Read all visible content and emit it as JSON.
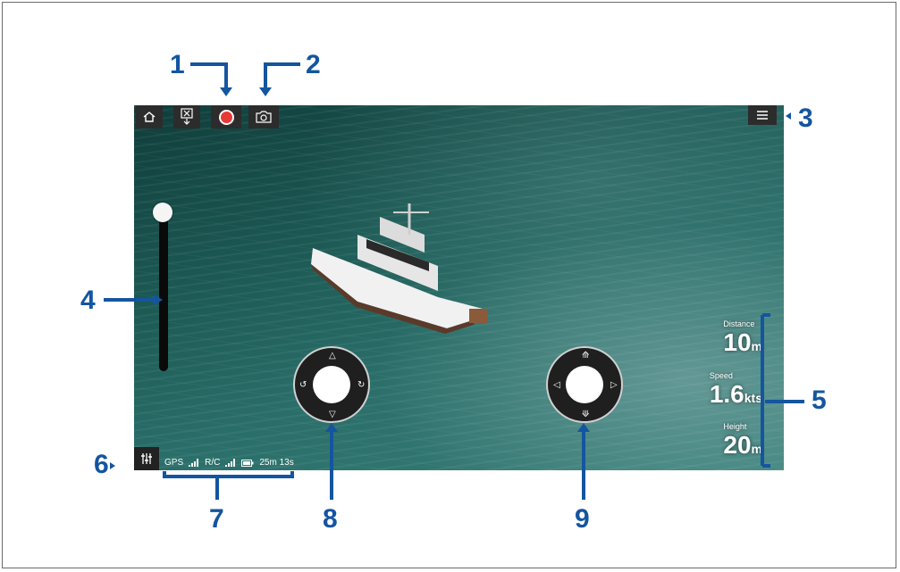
{
  "callouts": {
    "c1": "1",
    "c2": "2",
    "c3": "3",
    "c4": "4",
    "c5": "5",
    "c6": "6",
    "c7": "7",
    "c8": "8",
    "c9": "9"
  },
  "colors": {
    "callout": "#1455a0",
    "record": "#e53935",
    "ui_bg": "#2c2c2c"
  },
  "toolbar": {
    "home_icon": "home-icon",
    "retract_icon": "retract-icon",
    "record_icon": "record-icon",
    "camera_icon": "camera-icon",
    "menu_icon": "menu-icon"
  },
  "telemetry": {
    "distance_label": "Distance",
    "distance_value": "10",
    "distance_unit": "m",
    "speed_label": "Speed",
    "speed_value": "1.6",
    "speed_unit": "kts",
    "height_label": "Height",
    "height_value": "20",
    "height_unit": "m"
  },
  "status": {
    "gps_label": "GPS",
    "rc_label": "R/C",
    "battery_time": "25m 13s"
  },
  "altitude_slider": {
    "level": 1.0
  }
}
